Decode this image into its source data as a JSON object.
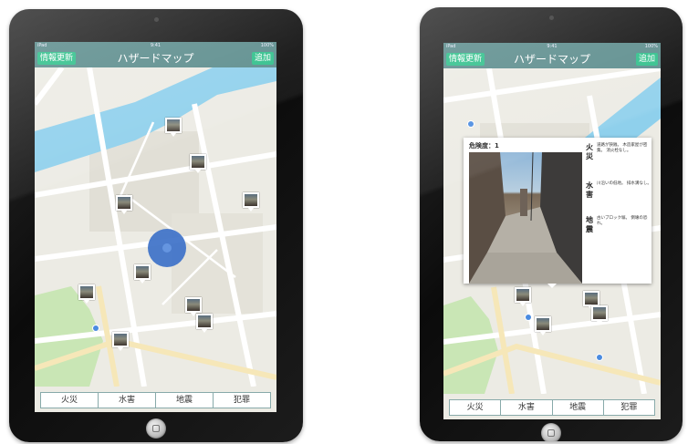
{
  "devices": [
    {
      "status": {
        "left": "iPad",
        "time": "9:41",
        "right": "100%"
      },
      "nav": {
        "left_button": "情報更新",
        "title": "ハザードマップ",
        "right_button": "追加"
      },
      "tabs": [
        "火災",
        "水害",
        "地震",
        "犯罪"
      ]
    },
    {
      "status": {
        "left": "iPad",
        "time": "9:41",
        "right": "100%"
      },
      "nav": {
        "left_button": "情報更新",
        "title": "ハザードマップ",
        "right_button": "追加"
      },
      "tabs": [
        "火災",
        "水害",
        "地震",
        "犯罪"
      ],
      "popup": {
        "danger": "危険度：1",
        "hazards": [
          {
            "label": "火災",
            "text": "道路が狭隘。 木造家屋が密集。 消火栓なし。"
          },
          {
            "label": "水害",
            "text": "川沿いの低地。 排水溝なし。"
          },
          {
            "label": "地震",
            "text": "古いブロック塀。 倒壊の恐れ。"
          }
        ]
      }
    }
  ],
  "colors": {
    "nav_bar": "#5b8c8c",
    "nav_button": "#2fbf8a",
    "map_base": "#ecebe4",
    "water": "#8fd0ec",
    "park": "#c9e6b5",
    "location": "#3f73c9"
  },
  "icons": [
    "photo-pin-icon",
    "current-location-icon",
    "water-drop-icon",
    "home-button-icon",
    "camera-icon"
  ]
}
